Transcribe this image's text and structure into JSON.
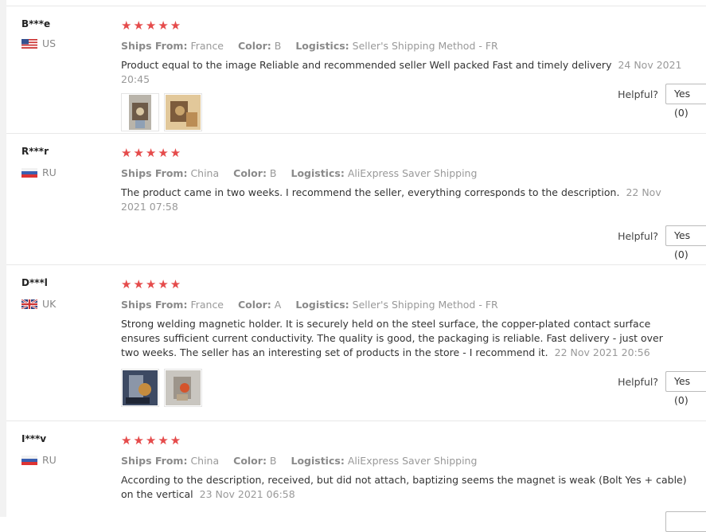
{
  "labels": {
    "ships_from": "Ships From:",
    "color": "Color:",
    "logistics": "Logistics:",
    "helpful": "Helpful?"
  },
  "reviews": [
    {
      "user": "B***e",
      "country": "US",
      "flag": "us-flag",
      "rating": 5,
      "stars": "★★★★★",
      "ships_from": "France",
      "color": "B",
      "logistics": "Seller's Shipping Method - FR",
      "text": "Product equal to the image Reliable and recommended seller Well packed Fast and timely delivery",
      "date": "24 Nov 2021 20:45",
      "photos": [
        "review-photo-icon",
        "review-photo-icon"
      ],
      "yes": "Yes (0)"
    },
    {
      "user": "R***r",
      "country": "RU",
      "flag": "ru-flag",
      "rating": 5,
      "stars": "★★★★★",
      "ships_from": "China",
      "color": "B",
      "logistics": "AliExpress Saver Shipping",
      "text": "The product came in two weeks. I recommend the seller, everything corresponds to the description.",
      "date": "22 Nov 2021 07:58",
      "photos": [],
      "yes": "Yes (0)"
    },
    {
      "user": "D***l",
      "country": "UK",
      "flag": "uk-flag",
      "rating": 5,
      "stars": "★★★★★",
      "ships_from": "France",
      "color": "A",
      "logistics": "Seller's Shipping Method - FR",
      "text": "Strong welding magnetic holder. It is securely held on the steel surface, the copper-plated contact surface ensures sufficient current conductivity. The quality is good, the packaging is reliable. Fast delivery - just over two weeks. The seller has an interesting set of products in the store - I recommend it.",
      "date": "22 Nov 2021 20:56",
      "photos": [
        "review-photo-icon",
        "review-photo-icon"
      ],
      "yes": "Yes (0)"
    },
    {
      "user": "I***v",
      "country": "RU",
      "flag": "ru-flag",
      "rating": 5,
      "stars": "★★★★★",
      "ships_from": "China",
      "color": "B",
      "logistics": "AliExpress Saver Shipping",
      "text": "According to the description, received, but did not attach, baptizing seems the magnet is weak (Bolt Yes + cable) on the vertical",
      "date": "23 Nov 2021 06:58",
      "photos": [],
      "yes": ""
    }
  ],
  "colors": {
    "star": "#e54b4b",
    "meta": "#999999",
    "divider": "#e8e8e8"
  }
}
